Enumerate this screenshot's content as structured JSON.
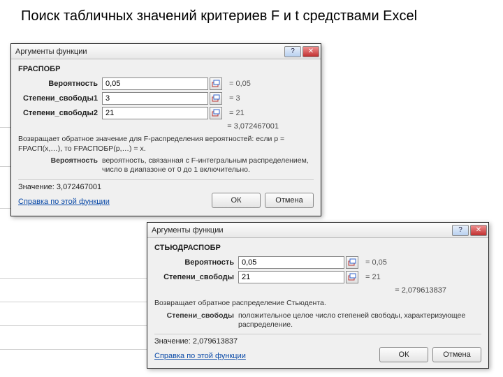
{
  "slide": {
    "title": "Поиск табличных значений критериев F и t средствами Excel"
  },
  "dlg1": {
    "title": "Аргументы функции",
    "fn": "FРАСПОБР",
    "args": [
      {
        "label": "Вероятность",
        "value": "0,05",
        "eq": "= 0,05"
      },
      {
        "label": "Степени_свободы1",
        "value": "3",
        "eq": "= 3"
      },
      {
        "label": "Степени_свободы2",
        "value": "21",
        "eq": "= 21"
      }
    ],
    "result_eq": "= 3,072467001",
    "desc": "Возвращает обратное значение для F-распределения вероятностей: если p = FРАСП(x,…), то FРАСПОБР(p,…) = x.",
    "argdesc_label": "Вероятность",
    "argdesc_text": "вероятность, связанная с F-интегральным распределением, число в диапазоне от 0 до 1 включительно.",
    "result_label": "Значение:",
    "result_value": "3,072467001",
    "helplink": "Справка по этой функции",
    "ok": "ОК",
    "cancel": "Отмена"
  },
  "dlg2": {
    "title": "Аргументы функции",
    "fn": "СТЬЮДРАСПОБР",
    "args": [
      {
        "label": "Вероятность",
        "value": "0,05",
        "eq": "= 0,05"
      },
      {
        "label": "Степени_свободы",
        "value": "21",
        "eq": "= 21"
      }
    ],
    "result_eq": "= 2,079613837",
    "desc": "Возвращает обратное распределение Стьюдента.",
    "argdesc_label": "Степени_свободы",
    "argdesc_text": "положительное целое число степеней свободы, характеризующее распределение.",
    "result_label": "Значение:",
    "result_value": "2,079613837",
    "helplink": "Справка по этой функции",
    "ok": "ОК",
    "cancel": "Отмена"
  }
}
